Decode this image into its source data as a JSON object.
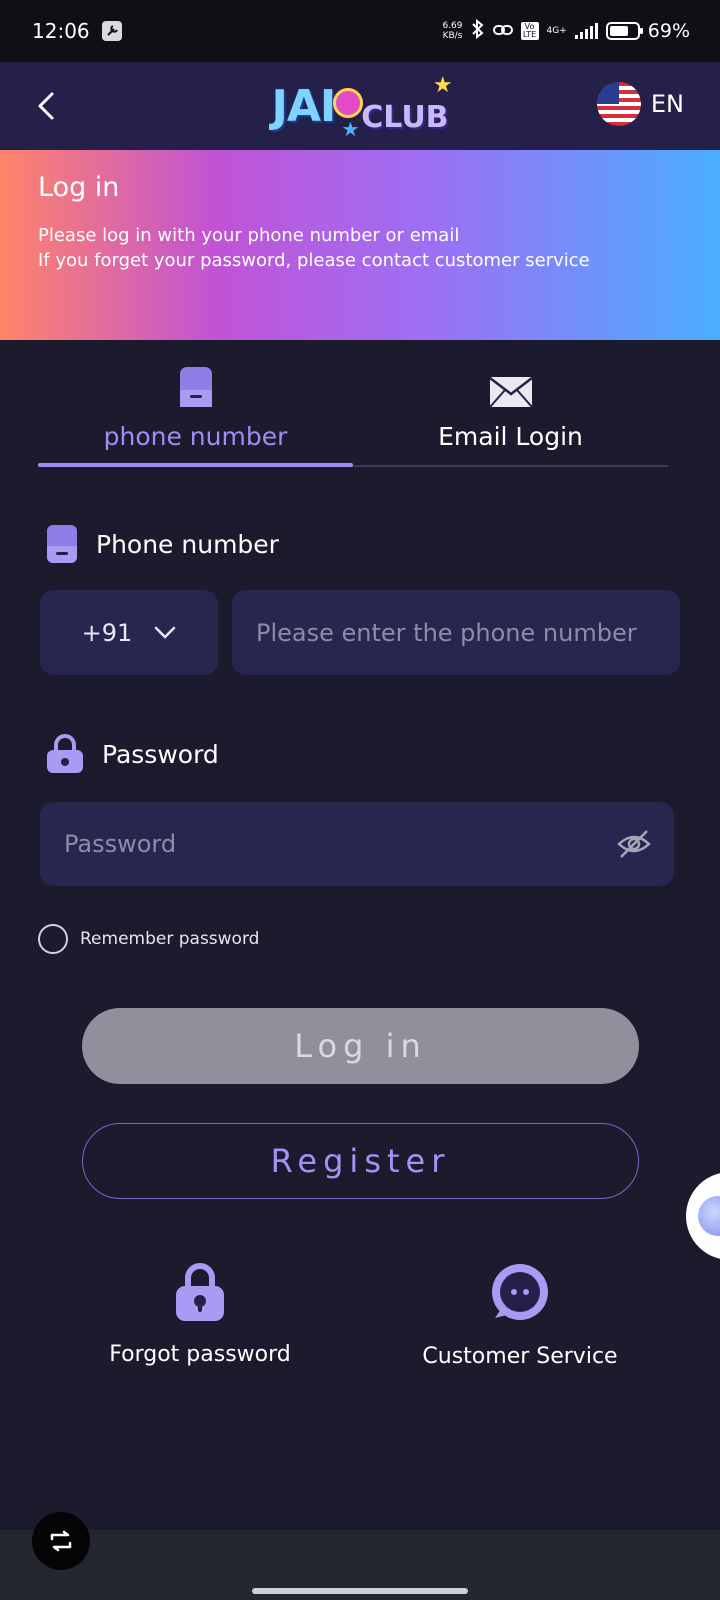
{
  "status_bar": {
    "time": "12:06",
    "net_speed_value": "6.69",
    "net_speed_unit": "KB/s",
    "battery": "69%",
    "battery_level": 0.69,
    "volte": "Vo LTE",
    "network": "4G+"
  },
  "header": {
    "logo_text_1": "JAI",
    "logo_text_2": "CLUB",
    "language": "EN",
    "back_icon": "chevron-left-icon",
    "flag_icon": "us-flag-icon"
  },
  "banner": {
    "title": "Log in",
    "line1": "Please log in with your phone number or email",
    "line2": "If you forget your password, please contact customer service"
  },
  "tabs": [
    {
      "label": "phone number",
      "icon": "phone-icon",
      "active": true
    },
    {
      "label": "Email Login",
      "icon": "envelope-icon",
      "active": false
    }
  ],
  "form": {
    "phone_label": "Phone number",
    "country_code": "+91",
    "phone_placeholder": "Please enter the phone number",
    "password_label": "Password",
    "password_placeholder": "Password",
    "remember_label": "Remember password"
  },
  "buttons": {
    "login": "Log in",
    "register": "Register"
  },
  "links": {
    "forgot": "Forgot password",
    "service": "Customer Service"
  },
  "colors": {
    "background": "#1c1b2e",
    "accent": "#a18cf6",
    "input_bg": "#28264f",
    "login_disabled": "#8f909c"
  }
}
